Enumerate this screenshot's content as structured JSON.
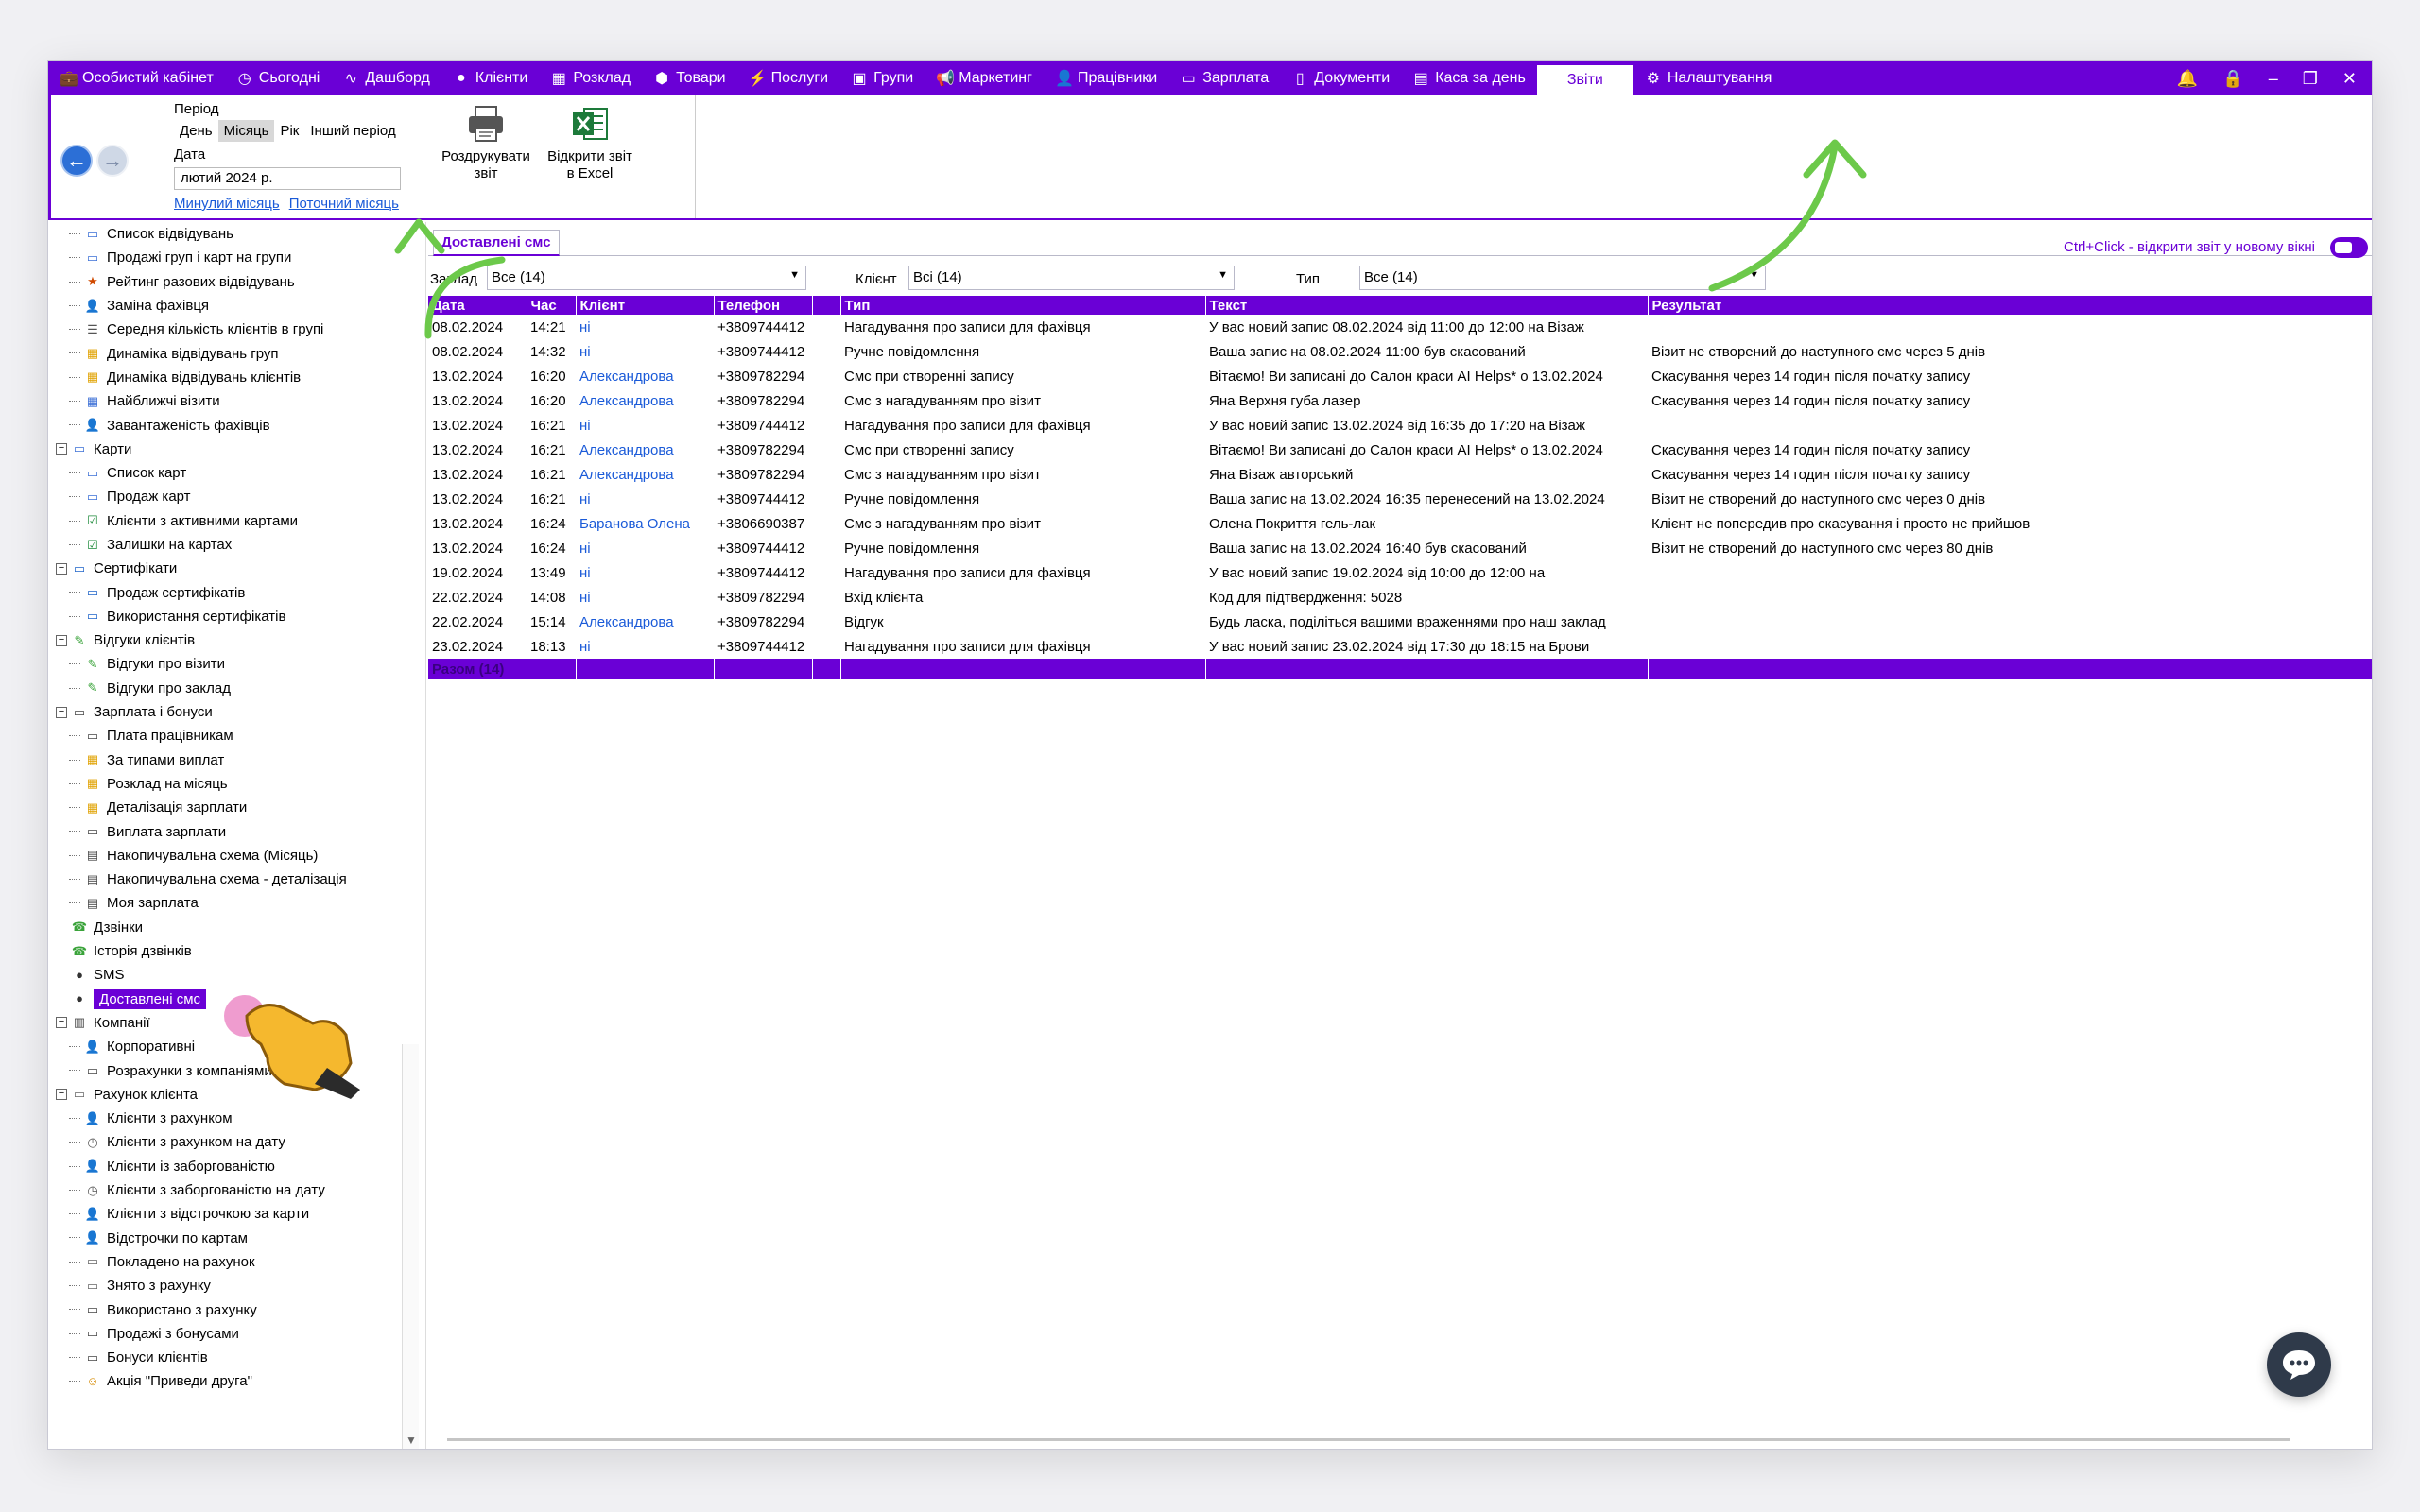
{
  "menu": {
    "items": [
      {
        "label": "Особистий кабінет",
        "icon": "briefcase-icon"
      },
      {
        "label": "Сьогодні",
        "icon": "clock-icon"
      },
      {
        "label": "Дашборд",
        "icon": "pulse-icon"
      },
      {
        "label": "Клієнти",
        "icon": "user-circle-icon"
      },
      {
        "label": "Розклад",
        "icon": "calendar-icon"
      },
      {
        "label": "Товари",
        "icon": "box-icon"
      },
      {
        "label": "Послуги",
        "icon": "lightning-icon"
      },
      {
        "label": "Групи",
        "icon": "groups-icon"
      },
      {
        "label": "Маркетинг",
        "icon": "megaphone-icon"
      },
      {
        "label": "Працівники",
        "icon": "person-icon"
      },
      {
        "label": "Зарплата",
        "icon": "money-icon"
      },
      {
        "label": "Документи",
        "icon": "document-icon"
      },
      {
        "label": "Каса за день",
        "icon": "calculator-icon"
      },
      {
        "label": "Звіти",
        "icon": "report-icon",
        "active": true
      },
      {
        "label": "Налаштування",
        "icon": "gear-icon"
      }
    ]
  },
  "toolbar": {
    "period_label": "Період",
    "period_options": [
      "День",
      "Місяць",
      "Рік",
      "Інший період"
    ],
    "period_selected": "Місяць",
    "date_label": "Дата",
    "date_value": "лютий  2024 р.",
    "prev_month_link": "Минулий місяць",
    "current_month_link": "Поточний місяць",
    "print_label": "Роздрукувати звіт",
    "excel_label": "Відкрити звіт в Excel"
  },
  "sidebar": {
    "items": [
      {
        "level": 2,
        "label": "Список відвідувань",
        "icon": "cards-icon"
      },
      {
        "level": 2,
        "label": "Продажі груп і карт на групи",
        "icon": "cards-icon"
      },
      {
        "level": 2,
        "label": "Рейтинг разових відвідувань",
        "icon": "rating-icon"
      },
      {
        "level": 2,
        "label": "Заміна фахівця",
        "icon": "person-icon"
      },
      {
        "level": 2,
        "label": "Середня кількість клієнтів в групі",
        "icon": "list-icon"
      },
      {
        "level": 2,
        "label": "Динаміка відвідувань груп",
        "icon": "grid-icon"
      },
      {
        "level": 2,
        "label": "Динаміка відвідувань клієнтів",
        "icon": "grid-icon"
      },
      {
        "level": 2,
        "label": "Найближчі візити",
        "icon": "calendar-icon"
      },
      {
        "level": 2,
        "label": "Завантаженість фахівців",
        "icon": "person-icon"
      },
      {
        "level": 1,
        "label": "Карти",
        "icon": "cards-icon",
        "expanded": true
      },
      {
        "level": 2,
        "label": "Список карт",
        "icon": "cards-icon"
      },
      {
        "level": 2,
        "label": "Продаж карт",
        "icon": "cards-icon"
      },
      {
        "level": 2,
        "label": "Клієнти з активними картами",
        "icon": "check-icon"
      },
      {
        "level": 2,
        "label": "Залишки на картах",
        "icon": "check-icon"
      },
      {
        "level": 1,
        "label": "Сертифікати",
        "icon": "certificate-icon",
        "expanded": true
      },
      {
        "level": 2,
        "label": "Продаж сертифікатів",
        "icon": "certificate-icon"
      },
      {
        "level": 2,
        "label": "Використання сертифікатів",
        "icon": "certificate-icon"
      },
      {
        "level": 1,
        "label": "Відгуки клієнтів",
        "icon": "feedback-icon",
        "expanded": true
      },
      {
        "level": 2,
        "label": "Відгуки про візити",
        "icon": "feedback-icon"
      },
      {
        "level": 2,
        "label": "Відгуки про заклад",
        "icon": "feedback-icon"
      },
      {
        "level": 1,
        "label": "Зарплата і бонуси",
        "icon": "money-icon",
        "expanded": true
      },
      {
        "level": 2,
        "label": "Плата працівникам",
        "icon": "money-icon"
      },
      {
        "level": 2,
        "label": "За типами виплат",
        "icon": "grid-icon"
      },
      {
        "level": 2,
        "label": "Розклад на місяць",
        "icon": "grid-icon"
      },
      {
        "level": 2,
        "label": "Деталізація зарплати",
        "icon": "grid-icon"
      },
      {
        "level": 2,
        "label": "Виплата зарплати",
        "icon": "money-icon"
      },
      {
        "level": 2,
        "label": "Накопичувальна схема (Місяць)",
        "icon": "calculator-icon"
      },
      {
        "level": 2,
        "label": "Накопичувальна схема - деталізація",
        "icon": "calculator-icon"
      },
      {
        "level": 2,
        "label": "Моя зарплата",
        "icon": "calculator-icon"
      },
      {
        "level": 1,
        "label": "Дзвінки",
        "icon": "phone-icon"
      },
      {
        "level": 1,
        "label": "Історія дзвінків",
        "icon": "phone-icon"
      },
      {
        "level": 1,
        "label": "SMS",
        "icon": "chat-bubble-icon"
      },
      {
        "level": 1,
        "label": "Доставлені смс",
        "icon": "chat-bubble-icon",
        "selected": true
      },
      {
        "level": 1,
        "label": "Компанії",
        "icon": "building-icon",
        "expanded": true
      },
      {
        "level": 2,
        "label": "Корпоративні",
        "icon": "person-icon"
      },
      {
        "level": 2,
        "label": "Розрахунки з компаніями",
        "icon": "money-icon"
      },
      {
        "level": 1,
        "label": "Рахунок клієнта",
        "icon": "wallet-icon",
        "expanded": true
      },
      {
        "level": 2,
        "label": "Клієнти з рахунком",
        "icon": "person-icon"
      },
      {
        "level": 2,
        "label": "Клієнти з рахунком на дату",
        "icon": "clock-icon"
      },
      {
        "level": 2,
        "label": "Клієнти із заборгованістю",
        "icon": "person-red-icon"
      },
      {
        "level": 2,
        "label": "Клієнти з заборгованістю на дату",
        "icon": "clock-icon"
      },
      {
        "level": 2,
        "label": "Клієнти з відстрочкою за карти",
        "icon": "person-red-icon"
      },
      {
        "level": 2,
        "label": "Відстрочки по картам",
        "icon": "person-red-icon"
      },
      {
        "level": 2,
        "label": "Покладено на рахунок",
        "icon": "wallet-icon"
      },
      {
        "level": 2,
        "label": "Знято з рахунку",
        "icon": "wallet-icon"
      },
      {
        "level": 2,
        "label": "Використано з рахунку",
        "icon": "money-icon"
      },
      {
        "level": 2,
        "label": "Продажі з бонусами",
        "icon": "money-icon"
      },
      {
        "level": 2,
        "label": "Бонуси клієнтів",
        "icon": "money-icon"
      },
      {
        "level": 2,
        "label": "Акція \"Приведи друга\"",
        "icon": "friends-icon"
      }
    ]
  },
  "main": {
    "tab_label": "Доставлені смс",
    "hint": "Ctrl+Click - відкрити звіт у новому вікні",
    "filters": {
      "zaklad_label": "Заклад",
      "zaklad_value": "Все (14)",
      "client_label": "Клієнт",
      "client_value": "Всі (14)",
      "type_label": "Тип",
      "type_value": "Все (14)"
    },
    "columns": [
      "Дата",
      "Час",
      "Клієнт",
      "Телефон",
      "",
      "Тип",
      "Текст",
      "Результат"
    ],
    "rows": [
      {
        "date": "08.02.2024",
        "time": "14:21",
        "client": "ні",
        "phone": "+3809744412",
        "type": "Нагадування про записи для фахівця",
        "text": "У вас новий запис 08.02.2024 від 11:00 до 12:00 на Візаж",
        "result": ""
      },
      {
        "date": "08.02.2024",
        "time": "14:32",
        "client": "ні",
        "phone": "+3809744412",
        "type": "Ручне повідомлення",
        "text": "Ваша запис на 08.02.2024 11:00 був скасований",
        "result": "Візит не створений до наступного смс через 5 днів"
      },
      {
        "date": "13.02.2024",
        "time": "16:20",
        "client": "Александрова",
        "phone": "+3809782294",
        "type": "Смс при створенні запису",
        "text": "Вітаємо! Ви записані до Салон краси AI Helps* о 13.02.2024",
        "result": "Скасування через 14 годин після початку запису"
      },
      {
        "date": "13.02.2024",
        "time": "16:20",
        "client": "Александрова",
        "phone": "+3809782294",
        "type": "Смс з нагадуванням про візит",
        "text": "Яна Верхня губа лазер",
        "result": "Скасування через 14 годин після початку запису"
      },
      {
        "date": "13.02.2024",
        "time": "16:21",
        "client": "ні",
        "phone": "+3809744412",
        "type": "Нагадування про записи для фахівця",
        "text": "У вас новий запис 13.02.2024 від 16:35 до 17:20 на Візаж",
        "result": ""
      },
      {
        "date": "13.02.2024",
        "time": "16:21",
        "client": "Александрова",
        "phone": "+3809782294",
        "type": "Смс при створенні запису",
        "text": "Вітаємо! Ви записані до Салон краси AI Helps* о 13.02.2024",
        "result": "Скасування через 14 годин після початку запису"
      },
      {
        "date": "13.02.2024",
        "time": "16:21",
        "client": "Александрова",
        "phone": "+3809782294",
        "type": "Смс з нагадуванням про візит",
        "text": "Яна Візаж авторський",
        "result": "Скасування через 14 годин після початку запису"
      },
      {
        "date": "13.02.2024",
        "time": "16:21",
        "client": "ні",
        "phone": "+3809744412",
        "type": "Ручне повідомлення",
        "text": "Ваша запис на 13.02.2024 16:35 перенесений на 13.02.2024",
        "result": "Візит не створений до наступного смс через 0 днів"
      },
      {
        "date": "13.02.2024",
        "time": "16:24",
        "client": "Баранова Олена",
        "phone": "+3806690387",
        "type": "Смс з нагадуванням про візит",
        "text": "Олена Покриття гель-лак",
        "result": "Клієнт не попередив про скасування і просто не прийшов"
      },
      {
        "date": "13.02.2024",
        "time": "16:24",
        "client": "ні",
        "phone": "+3809744412",
        "type": "Ручне повідомлення",
        "text": "Ваша запис на 13.02.2024 16:40 був скасований",
        "result": "Візит не створений до наступного смс через 80 днів"
      },
      {
        "date": "19.02.2024",
        "time": "13:49",
        "client": "ні",
        "phone": "+3809744412",
        "type": "Нагадування про записи для фахівця",
        "text": "У вас новий запис 19.02.2024 від 10:00 до 12:00 на",
        "result": ""
      },
      {
        "date": "22.02.2024",
        "time": "14:08",
        "client": "ні",
        "phone": "+3809782294",
        "type": "Вхід клієнта",
        "text": "Код для підтвердження: 5028",
        "result": ""
      },
      {
        "date": "22.02.2024",
        "time": "15:14",
        "client": "Александрова",
        "phone": "+3809782294",
        "type": "Відгук",
        "text": "Будь ласка, поділіться вашими враженнями про наш заклад",
        "result": ""
      },
      {
        "date": "23.02.2024",
        "time": "18:13",
        "client": "ні",
        "phone": "+3809744412",
        "type": "Нагадування про записи для фахівця",
        "text": "У вас новий запис 23.02.2024 від 17:30 до 18:15 на Брови",
        "result": ""
      }
    ],
    "total_label": "Разом (14)"
  },
  "colors": {
    "accent": "#6a00d6",
    "link": "#1a5ad8",
    "arrow": "#6cc94a"
  }
}
